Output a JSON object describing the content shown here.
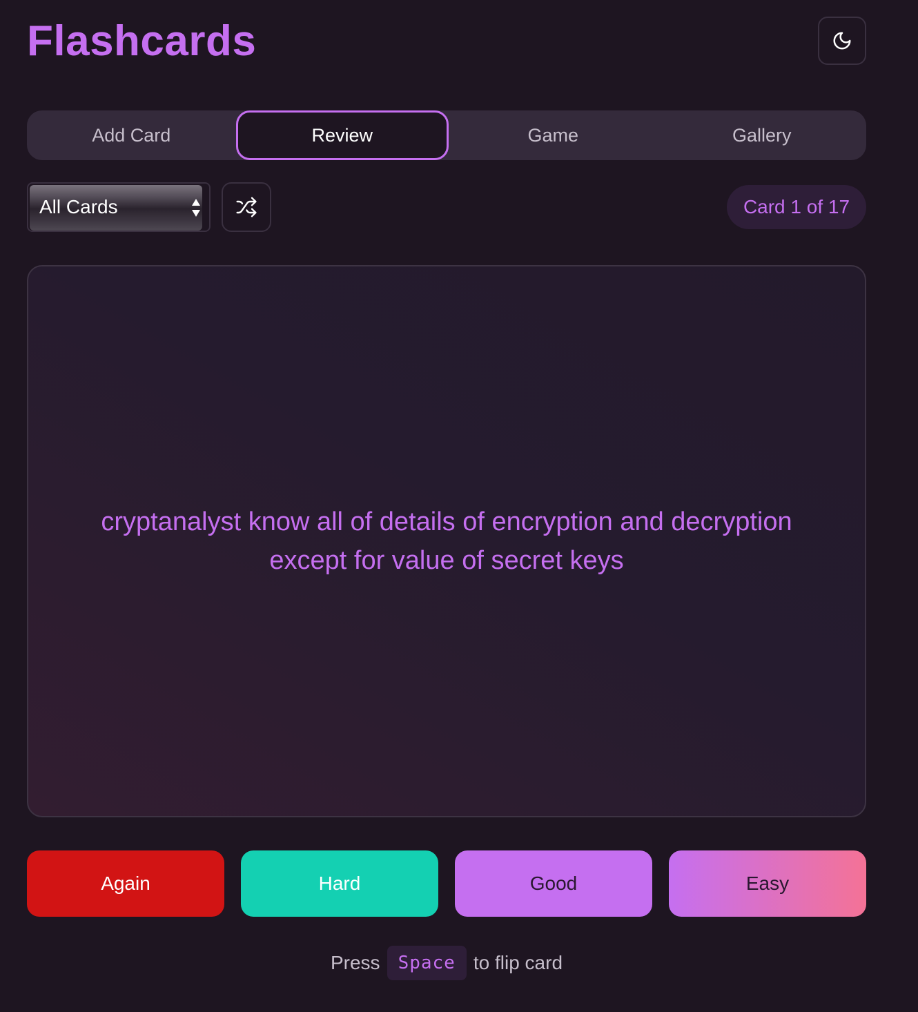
{
  "app": {
    "title": "Flashcards",
    "theme_toggle_icon": "moon-icon"
  },
  "tabs": [
    {
      "label": "Add Card",
      "active": false
    },
    {
      "label": "Review",
      "active": true
    },
    {
      "label": "Game",
      "active": false
    },
    {
      "label": "Gallery",
      "active": false
    }
  ],
  "controls": {
    "deck_select": {
      "selected": "All Cards"
    },
    "shuffle_icon": "shuffle-icon",
    "counter": "Card 1 of 17"
  },
  "card": {
    "text": "cryptanalyst know all of details of encryption and decryption except for value of secret keys"
  },
  "ratings": {
    "again": "Again",
    "hard": "Hard",
    "good": "Good",
    "easy": "Easy"
  },
  "hint": {
    "prefix": "Press",
    "key": "Space",
    "suffix": "to flip card"
  },
  "colors": {
    "accent": "#c56ff0",
    "background": "#1e1521",
    "again": "#d21414",
    "hard": "#14d0b2",
    "easy_end": "#f47296"
  }
}
